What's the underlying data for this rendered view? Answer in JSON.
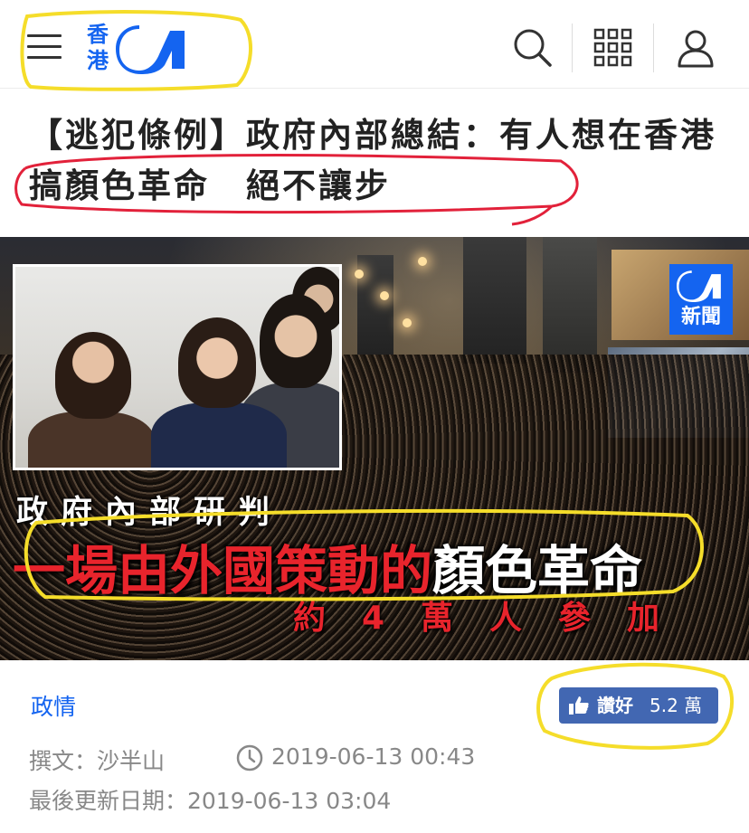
{
  "header": {
    "logo_text": "香港",
    "logo_brand": "01",
    "icons": [
      "menu-icon",
      "search-icon",
      "grid-icon",
      "user-icon"
    ]
  },
  "article": {
    "title": "【逃犯條例】政府內部總結：有人想在香港搞顏色革命　絕不讓步",
    "category": "政情",
    "author": "撰文：沙半山",
    "published": "2019-06-13 00:43",
    "updated": "最後更新日期：2019-06-13 03:04"
  },
  "hero": {
    "badge_label": "新聞",
    "caption_line1": "政府內部研判",
    "caption_line2_red": "一場由外國策動的",
    "caption_line2_white": "顏色革命",
    "caption_line3": "約4萬人參加"
  },
  "like": {
    "label": "讚好",
    "count": "5.2 萬"
  },
  "colors": {
    "brand_blue": "#1464f0",
    "facebook_blue": "#4267b2",
    "caption_red": "#e8242c",
    "meta_gray": "#888888",
    "annotation_yellow": "#f5dd2a",
    "annotation_red": "#e2213a"
  }
}
